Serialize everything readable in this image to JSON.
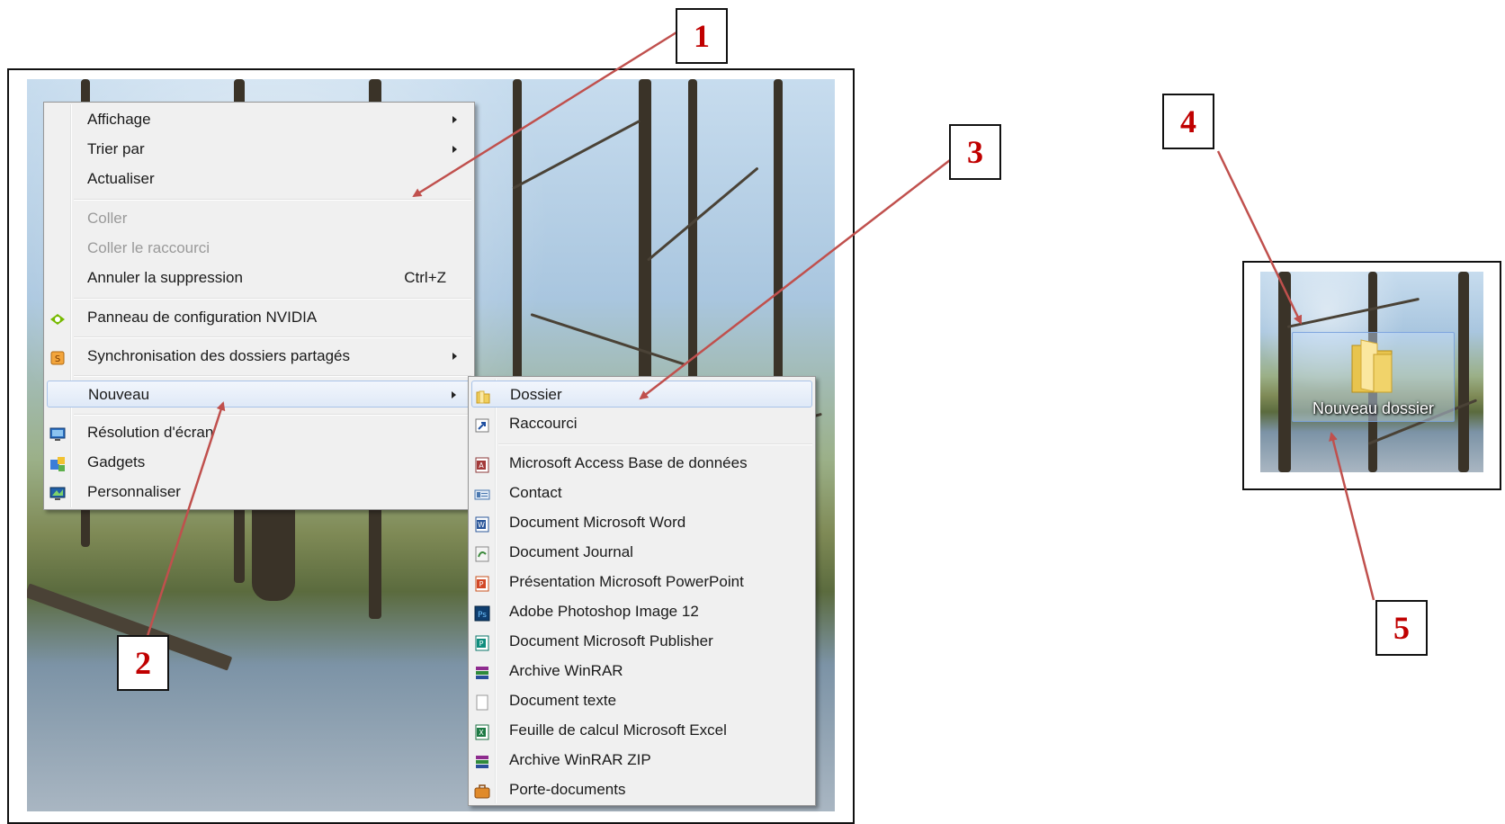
{
  "context_menu": {
    "items": [
      {
        "label": "Affichage",
        "submenu": true
      },
      {
        "label": "Trier par",
        "submenu": true
      },
      {
        "label": "Actualiser"
      },
      {
        "label": "Coller",
        "disabled": true
      },
      {
        "label": "Coller le raccourci",
        "disabled": true
      },
      {
        "label": "Annuler la suppression",
        "shortcut": "Ctrl+Z"
      },
      {
        "label": "Panneau de configuration NVIDIA",
        "icon": "nvidia-icon"
      },
      {
        "label": "Synchronisation des dossiers partagés",
        "icon": "sync-folders-icon",
        "submenu": true
      },
      {
        "label": "Nouveau",
        "submenu": true,
        "highlighted": true
      },
      {
        "label": "Résolution d'écran",
        "icon": "display-icon"
      },
      {
        "label": "Gadgets",
        "icon": "gadgets-icon"
      },
      {
        "label": "Personnaliser",
        "icon": "personalize-icon"
      }
    ]
  },
  "new_submenu": {
    "items": [
      {
        "label": "Dossier",
        "icon": "folder-icon",
        "highlighted": true
      },
      {
        "label": "Raccourci",
        "icon": "shortcut-icon"
      },
      {
        "label": "Microsoft Access Base de données",
        "icon": "access-icon"
      },
      {
        "label": "Contact",
        "icon": "contact-icon"
      },
      {
        "label": "Document Microsoft Word",
        "icon": "word-icon"
      },
      {
        "label": "Document Journal",
        "icon": "journal-icon"
      },
      {
        "label": "Présentation Microsoft PowerPoint",
        "icon": "powerpoint-icon"
      },
      {
        "label": "Adobe Photoshop Image 12",
        "icon": "photoshop-icon"
      },
      {
        "label": "Document Microsoft Publisher",
        "icon": "publisher-icon"
      },
      {
        "label": "Archive WinRAR",
        "icon": "winrar-icon"
      },
      {
        "label": "Document texte",
        "icon": "text-document-icon"
      },
      {
        "label": "Feuille de calcul Microsoft Excel",
        "icon": "excel-icon"
      },
      {
        "label": "Archive WinRAR ZIP",
        "icon": "winrar-zip-icon"
      },
      {
        "label": "Porte-documents",
        "icon": "briefcase-icon"
      }
    ]
  },
  "desktop_icon": {
    "label": "Nouveau dossier",
    "icon": "folder-icon"
  },
  "callouts": [
    "1",
    "2",
    "3",
    "4",
    "5"
  ],
  "colors": {
    "callout_number": "#c00000",
    "arrow": "#c0504d",
    "menu_bg": "#f0f0f0",
    "highlight_border": "#a8c3e8"
  }
}
